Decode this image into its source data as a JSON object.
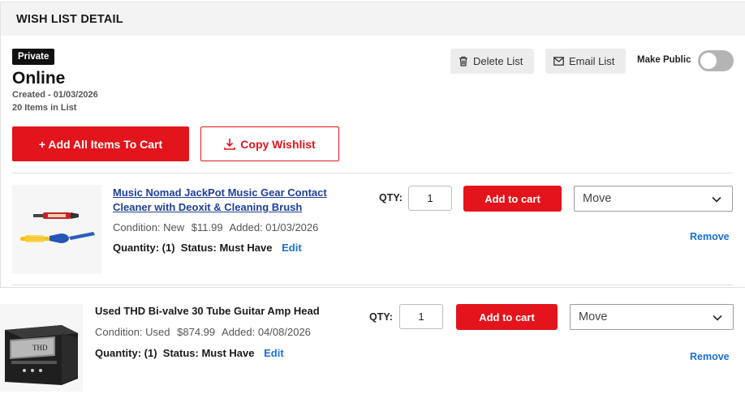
{
  "header": {
    "title": "WISH LIST DETAIL"
  },
  "list": {
    "privacy_badge": "Private",
    "name": "Online",
    "created": "Created - 01/03/2026",
    "count": "20 Items in List"
  },
  "actions": {
    "delete_label": "Delete List",
    "email_label": "Email List",
    "make_public_label": "Make Public",
    "make_public_on": false,
    "add_all_label": "+ Add All Items To Cart",
    "copy_label": "Copy Wishlist"
  },
  "items": [
    {
      "title_line1": "Music Nomad JackPot Music Gear Contact",
      "title_line2": "Cleaner with Deoxit & Cleaning Brush",
      "condition": "Condition: New",
      "price": "$11.99",
      "added": "Added: 01/03/2026",
      "quantity": "Quantity: (1)",
      "status": "Status: Must Have",
      "edit_label": "Edit",
      "qty_label": "QTY:",
      "qty_value": "1",
      "add_label": "Add to cart",
      "move_label": "Move",
      "remove_label": "Remove"
    },
    {
      "title_line1": "Used THD Bi-valve 30 Tube Guitar Amp Head",
      "condition": "Condition: Used",
      "price": "$874.99",
      "added": "Added: 04/08/2026",
      "quantity": "Quantity: (1)",
      "status": "Status: Must Have",
      "edit_label": "Edit",
      "qty_label": "QTY:",
      "qty_value": "1",
      "add_label": "Add to cart",
      "move_label": "Move",
      "remove_label": "Remove"
    }
  ],
  "icons": {
    "delete": "trash-icon",
    "email": "envelope-icon",
    "copy": "download-icon",
    "move": "chevron-down-icon"
  },
  "colors": {
    "accent_red": "#e3141b",
    "link_blue": "#1a6fd6",
    "title_link": "#1f3f99"
  }
}
